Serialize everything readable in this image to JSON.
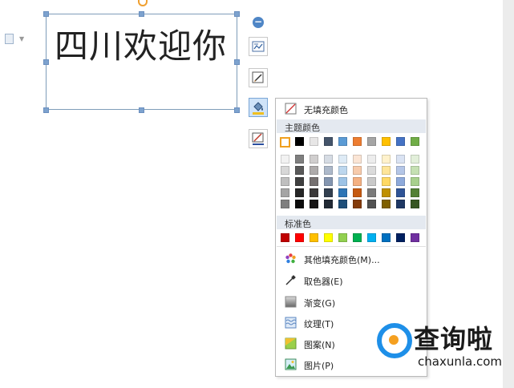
{
  "textbox": {
    "text": "四川欢迎你"
  },
  "menu": {
    "no_fill": "无填充颜色",
    "theme_colors_header": "主题颜色",
    "standard_colors_header": "标准色",
    "more_colors": "其他填充颜色(M)...",
    "eyedropper": "取色器(E)",
    "gradient": "渐变(G)",
    "texture": "纹理(T)",
    "pattern": "图案(N)",
    "picture": "图片(P)"
  },
  "theme_top_row": [
    "#ffffff",
    "#000000",
    "#e7e6e6",
    "#44546a",
    "#5b9bd5",
    "#ed7d31",
    "#a5a5a5",
    "#ffc000",
    "#4472c4",
    "#70ad47"
  ],
  "theme_shades": [
    [
      "#f2f2f2",
      "#7f7f7f",
      "#d0cece",
      "#d6dce4",
      "#deebf6",
      "#fbe5d5",
      "#ededed",
      "#fff2cc",
      "#dae3f3",
      "#e2efda"
    ],
    [
      "#d8d8d8",
      "#595959",
      "#aeabab",
      "#adb9ca",
      "#bdd7ee",
      "#f7cbac",
      "#dbdbdb",
      "#fee599",
      "#b4c6e7",
      "#c5e0b3"
    ],
    [
      "#bfbfbf",
      "#3f3f3f",
      "#757070",
      "#8496b0",
      "#9dc3e6",
      "#f4b183",
      "#c9c9c9",
      "#ffd965",
      "#8eaadb",
      "#a8d08d"
    ],
    [
      "#a5a5a5",
      "#262626",
      "#3a3838",
      "#323f4f",
      "#2e75b5",
      "#c55a11",
      "#7b7b7b",
      "#bf9000",
      "#2f5496",
      "#538135"
    ],
    [
      "#7f7f7f",
      "#0c0c0c",
      "#171616",
      "#222a35",
      "#1e4e79",
      "#843c0b",
      "#525252",
      "#7f6000",
      "#1f3864",
      "#375623"
    ]
  ],
  "standard_colors": [
    "#c00000",
    "#ff0000",
    "#ffc000",
    "#ffff00",
    "#92d050",
    "#00b050",
    "#00b0f0",
    "#0070c0",
    "#002060",
    "#7030a0"
  ],
  "watermark": {
    "title": "查询啦",
    "url": "chaxunla.com"
  },
  "colors": {
    "accent": "#4f86c6",
    "watermark_blue": "#1e8fe8",
    "watermark_orange": "#f5a020"
  }
}
